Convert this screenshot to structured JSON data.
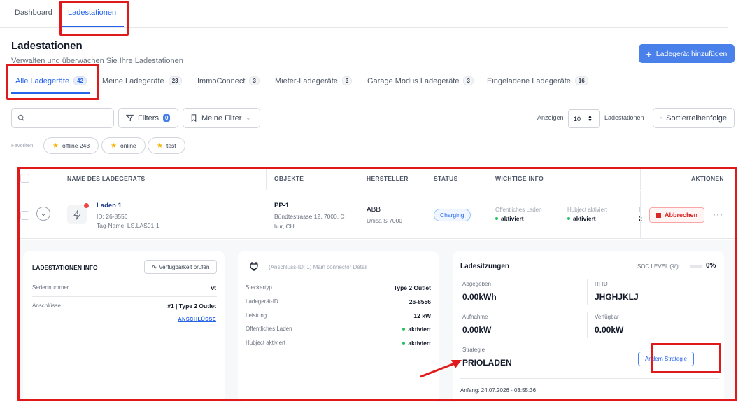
{
  "nav": {
    "tabs": [
      {
        "label": "Dashboard"
      },
      {
        "label": "Ladestationen"
      }
    ]
  },
  "page": {
    "title": "Ladestationen",
    "subtitle": "Verwalten und überwachen Sie Ihre Ladestationen",
    "add_button": "Ladegerät hinzufügen"
  },
  "filter_tabs": [
    {
      "label": "Alle Ladegeräte",
      "count": "42"
    },
    {
      "label": "Meine Ladegeräte",
      "count": "23"
    },
    {
      "label": "ImmoConnect",
      "count": "3"
    },
    {
      "label": "Mieter-Ladegeräte",
      "count": "3"
    },
    {
      "label": "Garage Modus Ladegeräte",
      "count": "3"
    },
    {
      "label": "Eingeladene Ladegeräte",
      "count": "16"
    }
  ],
  "toolbar": {
    "search_placeholder": "…",
    "filters_label": "Filters",
    "filters_count": "0",
    "my_filter_label": "Meine Filter",
    "show_label": "Anzeigen",
    "page_size": "10",
    "per_label": "Ladestationen",
    "sort_label": "Sortierreihenfolge"
  },
  "favorites": {
    "label": "Favoriten:",
    "items": [
      {
        "label": "offline 243"
      },
      {
        "label": "online"
      },
      {
        "label": "test"
      }
    ]
  },
  "table": {
    "headers": {
      "name": "NAME DES LADEGERÄTS",
      "objects": "OBJEKTE",
      "manufacturer": "HERSTELLER",
      "status": "STATUS",
      "info": "WICHTIGE INFO",
      "actions": "AKTIONEN"
    },
    "row": {
      "name": "Laden 1",
      "id": "ID: 26-8556",
      "tag": "Tag-Name: LS.LAS01-1",
      "object_name": "PP-1",
      "object_address_1": "Bündtestrasse 12, 7000, C",
      "object_address_2": "hur, CH",
      "manufacturer": "ABB",
      "model": "Unica S 7000",
      "status": "Charging",
      "info_1_label": "Öffentliches Laden",
      "info_1_value": "aktiviert",
      "info_2_label": "Hubject aktiviert",
      "info_2_value": "aktiviert",
      "info_3_label": "I",
      "info_3_value": "2",
      "cancel_button": "Abbrechen",
      "more": "···"
    }
  },
  "station_info": {
    "title": "LADESTATIONEN INFO",
    "check_button": "Verfügbarkeit prüfen",
    "serial_label": "Seriennummer",
    "serial_value": "vt",
    "connections_label": "Anschlüsse",
    "connections_value": "#1 | Type 2 Outlet",
    "connections_link": "ANSCHLÜSSE"
  },
  "connector": {
    "title": "(Anschluss-ID: 1) Main connector Detail",
    "rows": [
      {
        "label": "Steckertyp",
        "value": "Type 2 Outlet"
      },
      {
        "label": "Ladegerät-ID",
        "value": "26-8556"
      },
      {
        "label": "Leistung",
        "value": "12 kW"
      },
      {
        "label": "Öffentliches Laden",
        "value": "aktiviert"
      },
      {
        "label": "Hubject aktiviert",
        "value": "aktiviert"
      }
    ]
  },
  "session": {
    "title": "Ladesitzungen",
    "soc_label": "SOC LEVEL (%):",
    "soc_value": "0%",
    "soc_level": 0,
    "delivered_label": "Abgegeben",
    "delivered_value": "0.00kWh",
    "rfid_label": "RFID",
    "rfid_value": "JHGHJKLJ",
    "intake_label": "Aufnahme",
    "intake_value": "0.00kW",
    "available_label": "Verfügbar",
    "available_value": "0.00kW",
    "strategy_label": "Strategie",
    "strategy_value": "PRIOLADEN",
    "strategy_button": "Ändern Strategie",
    "start_label": "Anfang: 24.07.2026 - 03:55:36"
  },
  "colors": {
    "accent": "#4a80ea",
    "annotation_red": "#e0191b",
    "status_blue": "#2563eb",
    "active_green": "#22c55e",
    "cancel_red": "#dc2626"
  }
}
